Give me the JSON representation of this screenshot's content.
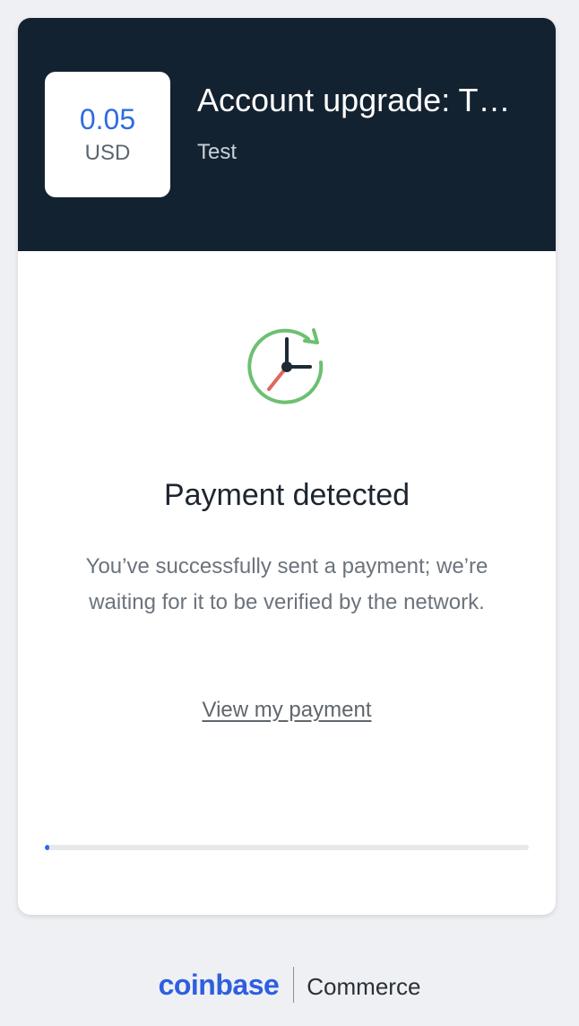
{
  "header": {
    "price_amount": "0.05",
    "price_currency": "USD",
    "title": "Account upgrade: T…",
    "subtitle": "Test"
  },
  "status": {
    "icon": "clock-refresh-icon",
    "title": "Payment detected",
    "description": "You’ve successfully sent a payment; we’re waiting for it to be verified by the network.",
    "link_label": "View my payment"
  },
  "progress": {
    "fraction": 0.01
  },
  "footer": {
    "brand": "coinbase",
    "product": "Commerce"
  },
  "colors": {
    "header_bg": "#132231",
    "accent_blue": "#2f6ce0",
    "clock_ring": "#6cc070",
    "clock_hand_red": "#e0675c",
    "page_bg": "#eef0f4"
  }
}
